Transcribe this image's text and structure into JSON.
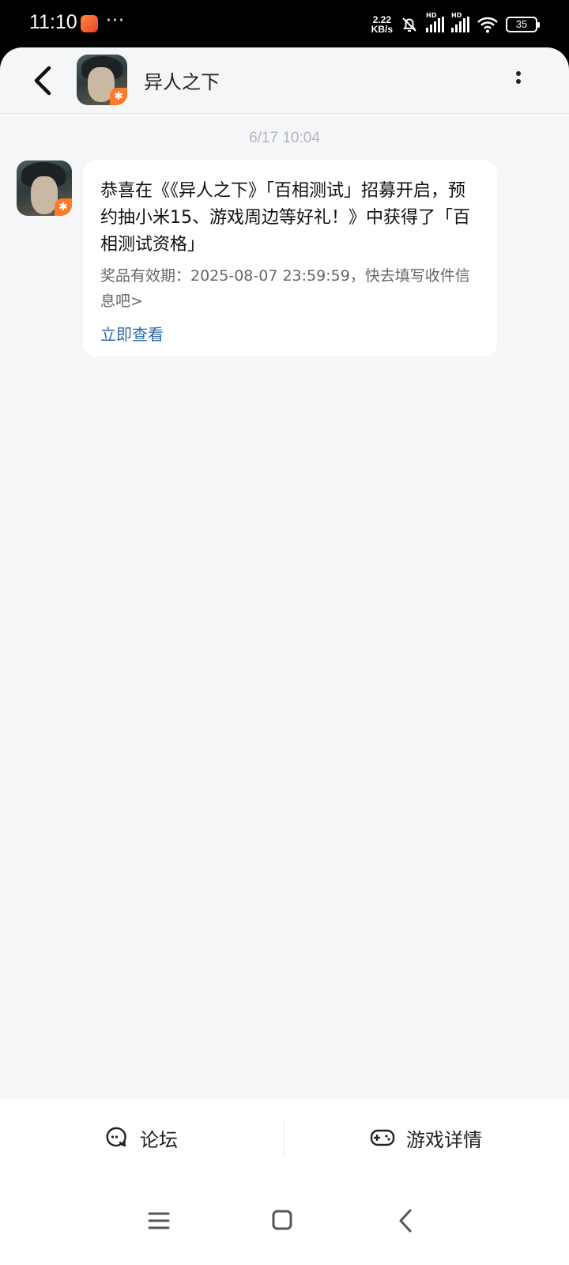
{
  "status_bar": {
    "time": "11:10",
    "dots": "···",
    "net_speed_value": "2.22",
    "net_speed_unit": "KB/s",
    "signal_label": "HD",
    "battery": "35"
  },
  "header": {
    "title": "异人之下",
    "avatar_icon": "game-avatar-icon"
  },
  "conversation": {
    "timestamp": "6/17  10:04",
    "message": {
      "body": "恭喜在《《异人之下》「百相测试」招募开启，预约抽小米15、游戏周边等好礼！》中获得了「百相测试资格」",
      "meta": "奖品有效期：2025-08-07 23:59:59，快去填写收件信息吧>",
      "link": "立即查看"
    }
  },
  "bottom_tabs": [
    {
      "label": "论坛",
      "icon": "forum-chat-icon"
    },
    {
      "label": "游戏详情",
      "icon": "gamepad-icon"
    }
  ],
  "colors": {
    "background": "#f5f6f8",
    "link": "#2e6aa8",
    "badge": "#ff7a2a"
  }
}
